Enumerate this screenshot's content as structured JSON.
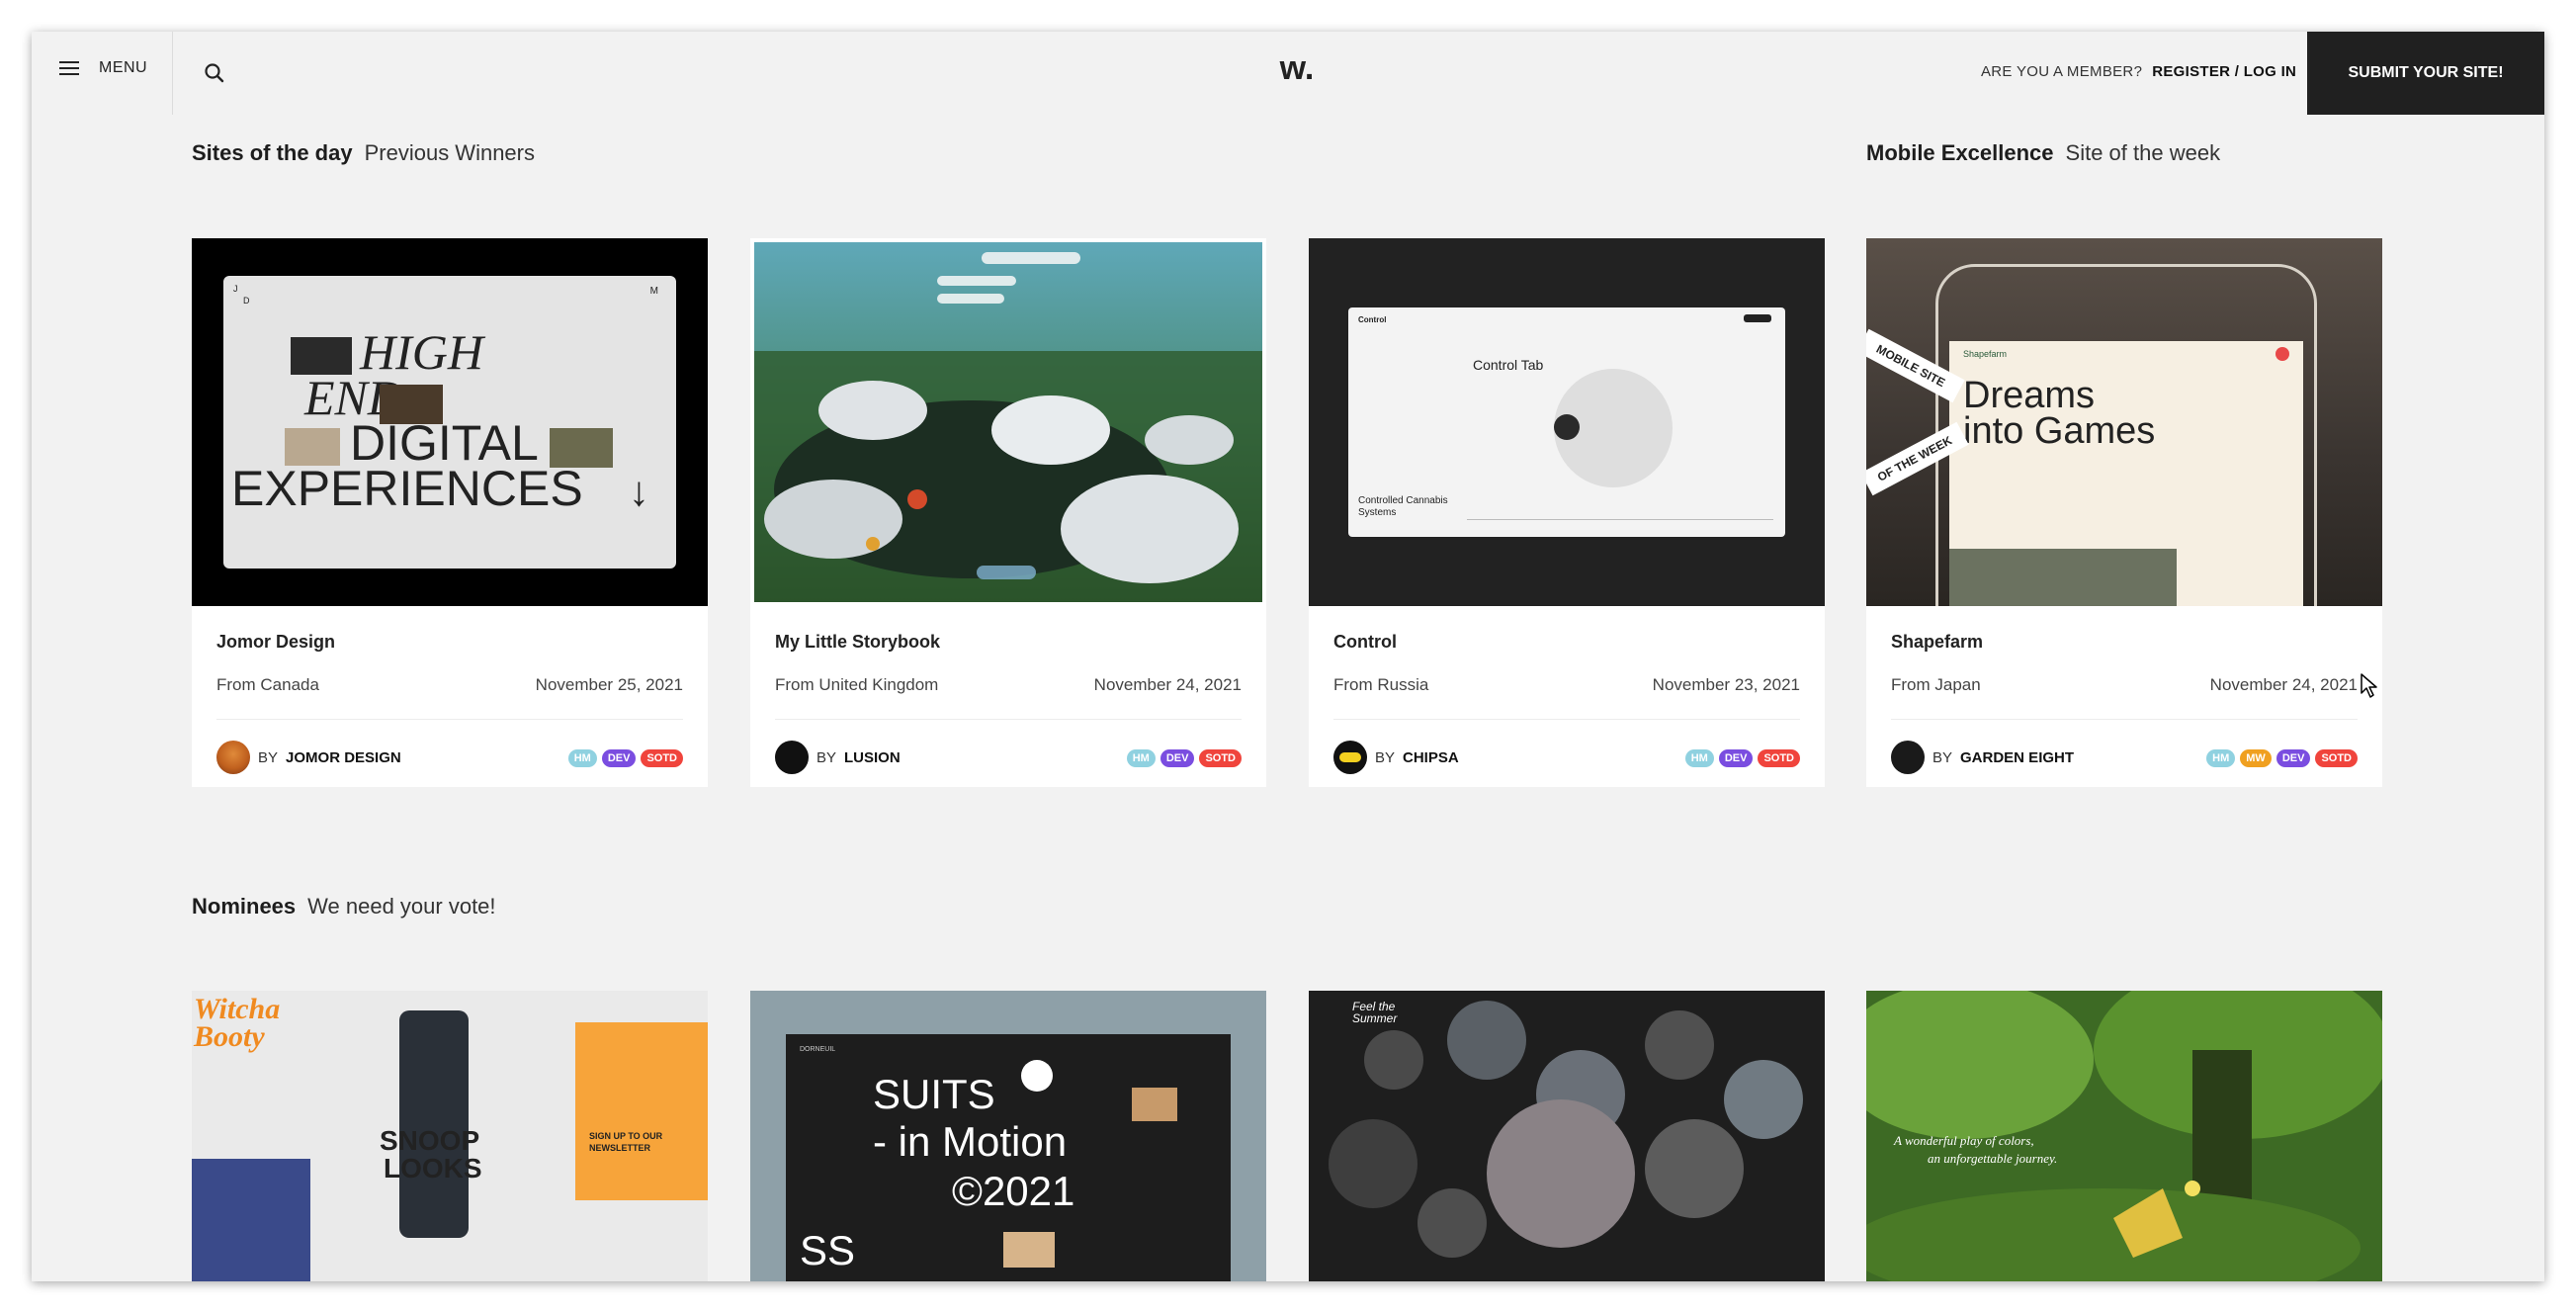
{
  "header": {
    "menu_label": "MENU",
    "logo": "w.",
    "member_question": "ARE YOU A MEMBER?",
    "register_login": "REGISTER / LOG IN",
    "submit_label": "SUBMIT YOUR SITE!"
  },
  "sections": {
    "sotd_title": "Sites of the day",
    "sotd_sub": "Previous Winners",
    "mobile_title": "Mobile Excellence",
    "mobile_sub": "Site of the week",
    "nominees_title": "Nominees",
    "nominees_sub": "We need your vote!"
  },
  "cards": [
    {
      "name": "Jomor Design",
      "from": "From Canada",
      "date": "November 25, 2021",
      "by": "BY",
      "author": "JOMOR DESIGN",
      "badges": [
        "HM",
        "DEV",
        "SOTD"
      ],
      "thumb": {
        "corner_left": "J",
        "corner_sub": "D",
        "corner_right": "M",
        "line1": "HIGH",
        "line2": "END",
        "line3": "DIGITAL",
        "line4": "EXPERIENCES",
        "arrow": "↓"
      }
    },
    {
      "name": "My Little Storybook",
      "from": "From United Kingdom",
      "date": "November 24, 2021",
      "by": "BY",
      "author": "LUSION",
      "badges": [
        "HM",
        "DEV",
        "SOTD"
      ]
    },
    {
      "name": "Control",
      "from": "From Russia",
      "date": "November 23, 2021",
      "by": "BY",
      "author": "CHIPSA",
      "badges": [
        "HM",
        "DEV",
        "SOTD"
      ],
      "thumb": {
        "brand": "Control",
        "heading": "Control Tab",
        "footer": "Controlled Cannabis Systems"
      }
    },
    {
      "name": "Shapefarm",
      "from": "From Japan",
      "date": "November 24, 2021",
      "by": "BY",
      "author": "GARDEN EIGHT",
      "badges": [
        "HM",
        "MW",
        "DEV",
        "SOTD"
      ],
      "thumb": {
        "ribbon1": "MOBILE SITE",
        "ribbon2": "OF THE WEEK",
        "headline1": "Dreams",
        "headline2": "into Games",
        "logo": "Shapefarm"
      }
    }
  ],
  "nominees": [
    {
      "thumb_text": [
        "Witcha",
        "Booty",
        "SNOOP",
        "LOOKS",
        "SIGN UP TO OUR",
        "NEWSLETTER"
      ]
    },
    {
      "thumb_text": [
        "DORNEUIL",
        "SUITS",
        "- in Motion",
        "©2021",
        "SS"
      ]
    },
    {
      "thumb_text": [
        "Feel the Summer"
      ]
    },
    {
      "thumb_text": [
        "A wonderful play of colors,",
        "an unforgettable journey."
      ]
    }
  ],
  "colors": {
    "page_bg": "#f2f2f2",
    "submit_bg": "#202020",
    "badge_hm": "#8fd1e0",
    "badge_mw": "#f0a020",
    "badge_dev": "#7a4de0",
    "badge_sotd": "#f0443c"
  }
}
